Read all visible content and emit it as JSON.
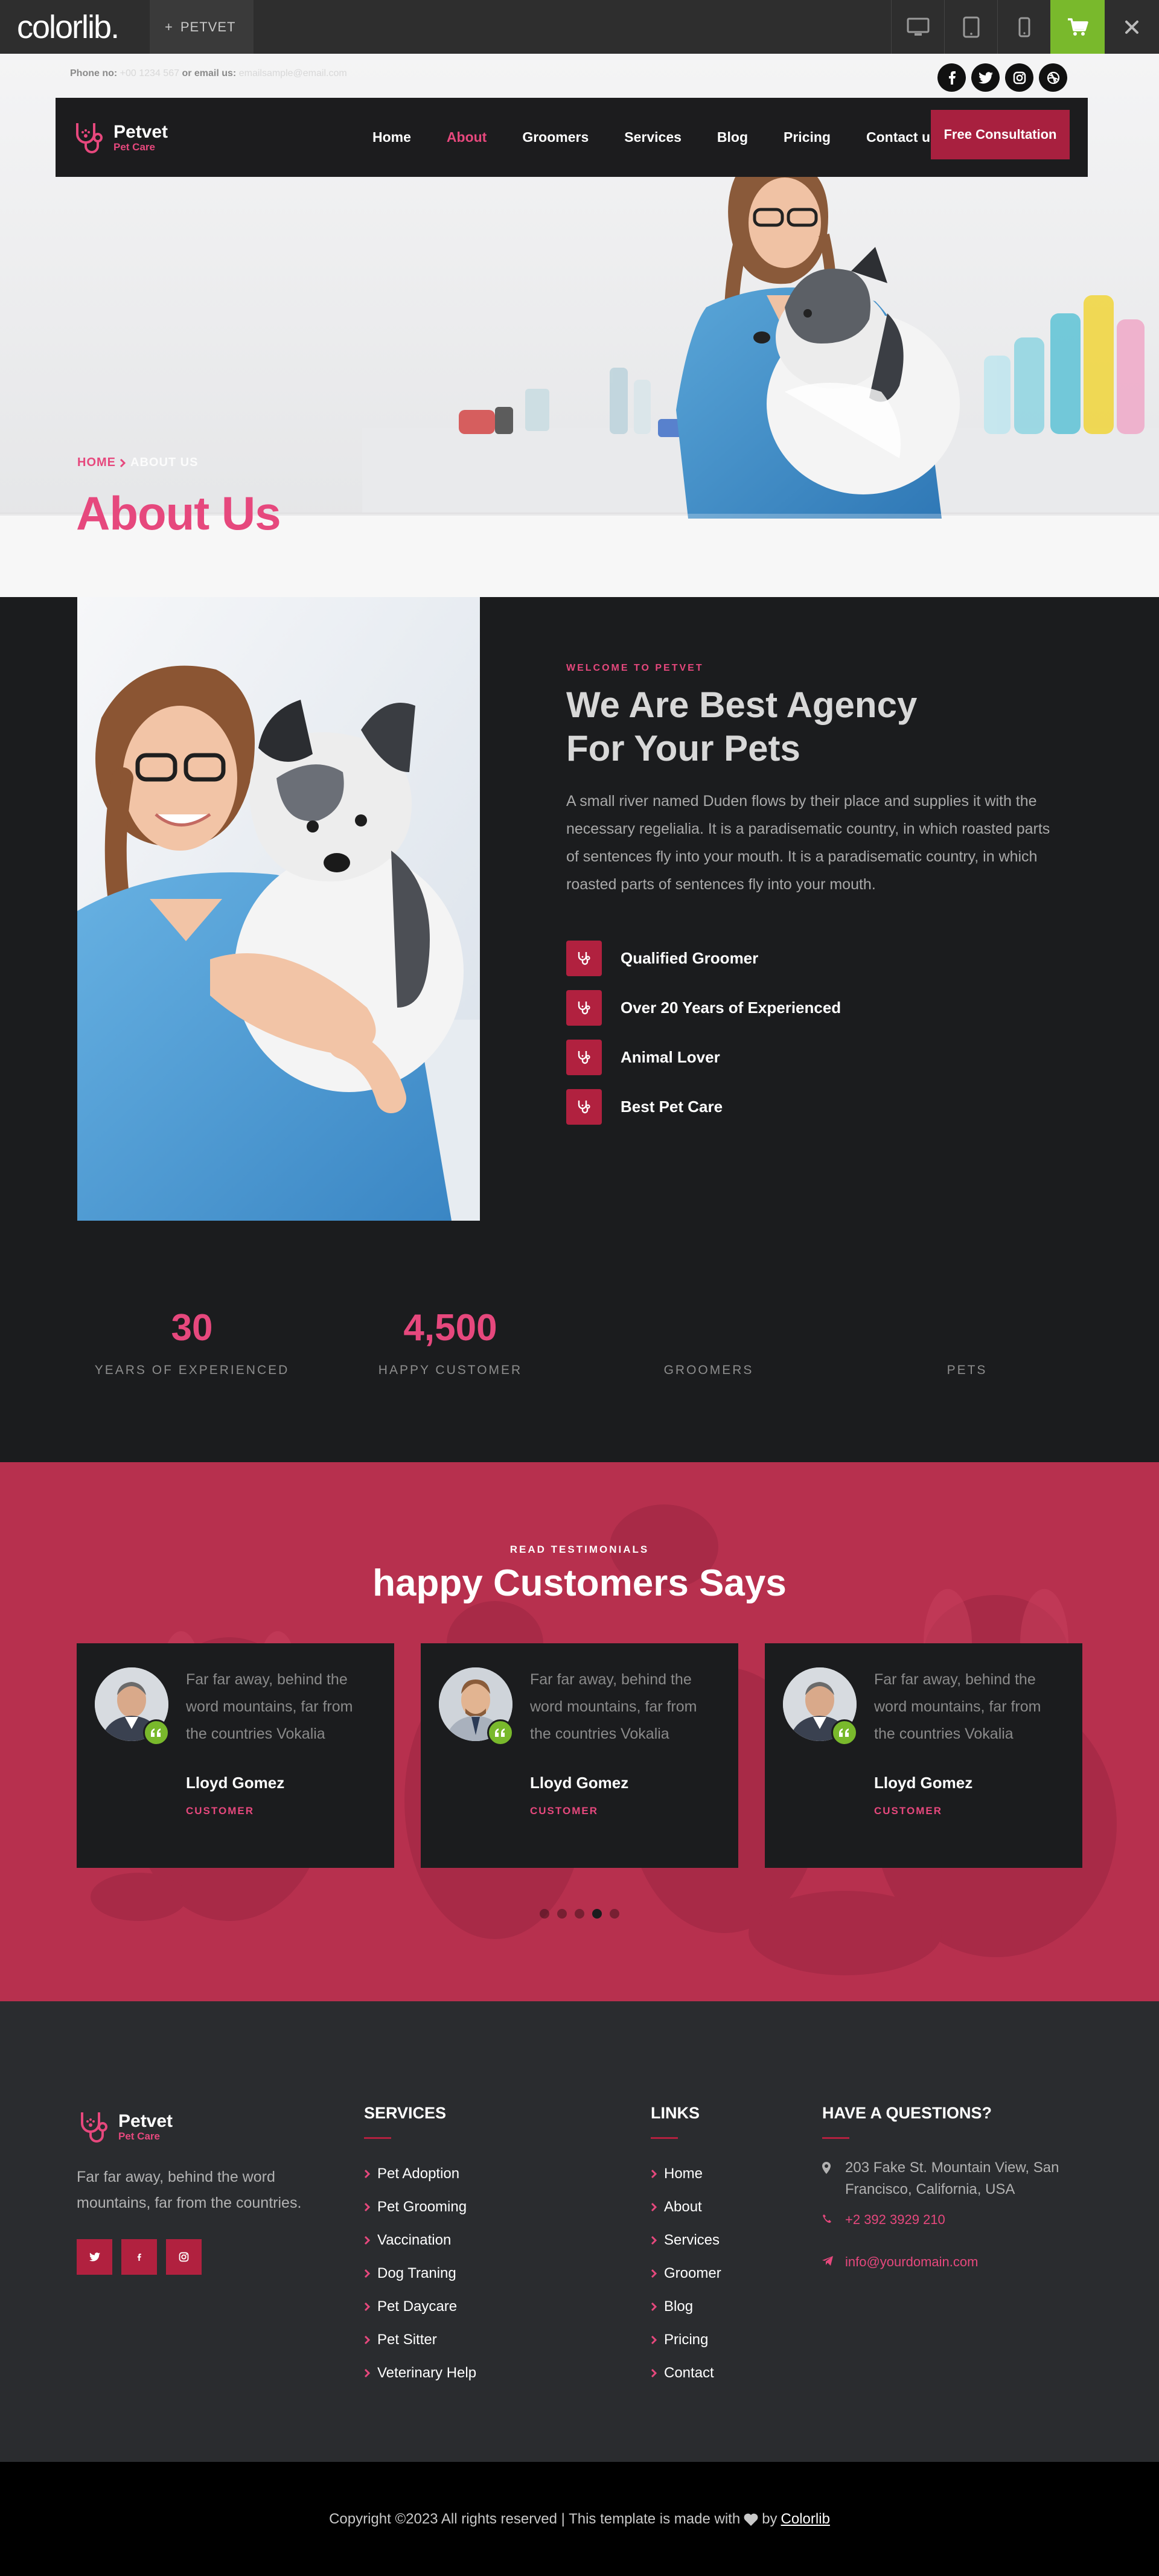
{
  "preview_bar": {
    "logo": "colorlib.",
    "theme_name": "PETVET",
    "devices": [
      "desktop-icon",
      "tablet-icon",
      "mobile-icon"
    ],
    "cart_color": "#79b92c"
  },
  "topbar": {
    "phone_label": "Phone no:",
    "phone_value": "+00 1234 567",
    "email_label": "or email us:",
    "email_value": "emailsample@email.com",
    "socials": [
      "facebook-icon",
      "twitter-icon",
      "instagram-icon",
      "dribbble-icon"
    ]
  },
  "brand": {
    "name": "Petvet",
    "tagline": "Pet Care"
  },
  "nav": {
    "items": [
      {
        "label": "Home",
        "active": false
      },
      {
        "label": "About",
        "active": true
      },
      {
        "label": "Groomers",
        "active": false
      },
      {
        "label": "Services",
        "active": false
      },
      {
        "label": "Blog",
        "active": false
      },
      {
        "label": "Pricing",
        "active": false
      },
      {
        "label": "Contact us",
        "active": false
      }
    ],
    "cta": "Free Consultation"
  },
  "hero": {
    "breadcrumb_home": "HOME",
    "breadcrumb_current": "ABOUT US",
    "title": "About Us"
  },
  "about": {
    "eyebrow": "WELCOME TO PETVET",
    "title_line1": "We Are Best Agency",
    "title_line2": "For Your Pets",
    "paragraph": "A small river named Duden flows by their place and supplies it with the necessary regelialia. It is a paradisematic country, in which roasted parts of sentences fly into your mouth. It is a paradisematic country, in which roasted parts of sentences fly into your mouth.",
    "features": [
      "Qualified Groomer",
      "Over 20 Years of Experienced",
      "Animal Lover",
      "Best Pet Care"
    ]
  },
  "counters": [
    {
      "value": "30",
      "label": "YEARS OF EXPERIENCED"
    },
    {
      "value": "4,500",
      "label": "HAPPY CUSTOMER"
    },
    {
      "value": "",
      "label": "GROOMERS"
    },
    {
      "value": "",
      "label": "PETS"
    }
  ],
  "testimonials": {
    "eyebrow": "READ TESTIMONIALS",
    "title": "happy Customers Says",
    "items": [
      {
        "text": "Far far away, behind the word mountains, far from the countries Vokalia",
        "name": "Lloyd Gomez",
        "role": "CUSTOMER"
      },
      {
        "text": "Far far away, behind the word mountains, far from the countries Vokalia",
        "name": "Lloyd Gomez",
        "role": "CUSTOMER"
      },
      {
        "text": "Far far away, behind the word mountains, far from the countries Vokalia",
        "name": "Lloyd Gomez",
        "role": "CUSTOMER"
      }
    ],
    "dots": 5,
    "active_dot": 4
  },
  "footer": {
    "about": "Far far away, behind the word mountains, far from the countries.",
    "socials": [
      "twitter-icon",
      "facebook-icon",
      "instagram-icon"
    ],
    "services_heading": "SERVICES",
    "services": [
      "Pet Adoption",
      "Pet Grooming",
      "Vaccination",
      "Dog Traning",
      "Pet Daycare",
      "Pet Sitter",
      "Veterinary Help"
    ],
    "links_heading": "LINKS",
    "links": [
      "Home",
      "About",
      "Services",
      "Groomer",
      "Blog",
      "Pricing",
      "Contact"
    ],
    "questions_heading": "HAVE A QUESTIONS?",
    "address": "203 Fake St. Mountain View, San Francisco, California, USA",
    "phone": "+2 392 3929 210",
    "email": "info@yourdomain.com"
  },
  "copyright": {
    "text": "Copyright ©2023 All rights reserved | This template is made with",
    "by": "by",
    "link": "Colorlib"
  },
  "colors": {
    "accent_pink": "#e6487d",
    "brand_red": "#b1213f",
    "dark": "#1b1c1e",
    "testimonial_bg": "#b72f4d",
    "footer_bg": "#2a2c2f"
  }
}
